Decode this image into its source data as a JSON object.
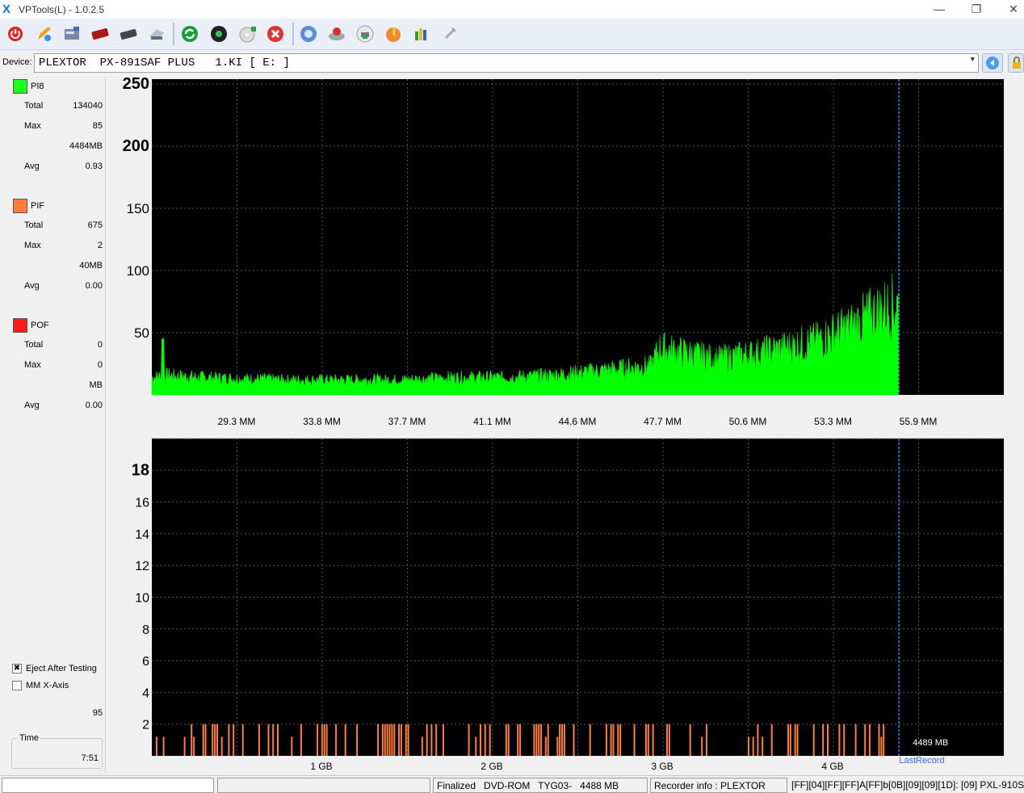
{
  "window": {
    "title": "VPTools(L) - 1.0.2.5",
    "logo": "X",
    "minimize": "—",
    "maximize": "❐",
    "close": "✕"
  },
  "toolbar": {
    "icons": [
      "power-icon",
      "pencil-icon",
      "drive-info-icon",
      "disc-red-icon",
      "disc-dark-icon",
      "scanner-icon",
      "refresh-icon",
      "disc-scan-icon",
      "disc-add-icon",
      "stop-icon",
      "disc-blue-icon",
      "disc-burn-icon",
      "printer-icon",
      "fire-icon",
      "chart-icon",
      "settings-icon"
    ]
  },
  "device": {
    "label": "Device:",
    "value": "PLEXTOR  PX-891SAF PLUS   1.KI [ E: ]",
    "arrow": "▼"
  },
  "stats": {
    "pi8": {
      "name": "PI8",
      "color": "#1dff1d",
      "total_label": "Total",
      "total": "134040",
      "max_label": "Max",
      "max": "85",
      "max_pos": "4484MB",
      "avg_label": "Avg",
      "avg": "0.93"
    },
    "pif": {
      "name": "PIF",
      "color": "#ff7f3a",
      "total_label": "Total",
      "total": "675",
      "max_label": "Max",
      "max": "2",
      "max_pos": "40MB",
      "avg_label": "Avg",
      "avg": "0.00"
    },
    "pof": {
      "name": "POF",
      "color": "#ff1c1c",
      "total_label": "Total",
      "total": "0",
      "max_label": "Max",
      "max": "0",
      "max_pos": "MB",
      "avg_label": "Avg",
      "avg": "0.00"
    }
  },
  "options": {
    "eject_label": "Eject After Testing",
    "eject_checked": "✖",
    "mm_label": "MM X-Axis",
    "speed_value": "95",
    "time_label": "Time",
    "time_value": "7:51"
  },
  "chart_data": [
    {
      "type": "area",
      "series": [
        {
          "name": "PI8",
          "color": "#00ff00"
        }
      ],
      "y_ticks": [
        50,
        100,
        150,
        200,
        250
      ],
      "ylim": [
        0,
        250
      ],
      "x_tick_labels": [
        "29.3 MM",
        "33.8 MM",
        "37.7 MM",
        "41.1 MM",
        "44.6 MM",
        "47.7 MM",
        "50.6 MM",
        "53.3 MM",
        "55.9 MM"
      ],
      "x_data_range_mb": [
        0,
        4489
      ],
      "envelope": [
        [
          0,
          15
        ],
        [
          80,
          17
        ],
        [
          300,
          15
        ],
        [
          800,
          13
        ],
        [
          1200,
          13
        ],
        [
          1500,
          13
        ],
        [
          1800,
          15
        ],
        [
          2100,
          15
        ],
        [
          2400,
          17
        ],
        [
          2700,
          21
        ],
        [
          3000,
          25
        ],
        [
          3050,
          40
        ],
        [
          3200,
          36
        ],
        [
          3400,
          31
        ],
        [
          3600,
          35
        ],
        [
          3800,
          40
        ],
        [
          4000,
          46
        ],
        [
          4200,
          58
        ],
        [
          4350,
          70
        ],
        [
          4484,
          78
        ]
      ],
      "last_record_mb": 4489,
      "background": "#000000",
      "grid": true
    },
    {
      "type": "bar",
      "series": [
        {
          "name": "PIF",
          "color": "#ff7f3a"
        }
      ],
      "y_ticks": [
        2,
        4,
        6,
        8,
        10,
        12,
        14,
        16,
        18
      ],
      "ylim": [
        0,
        20
      ],
      "x_tick_labels": [
        "1 GB",
        "2 GB",
        "3 GB",
        "4 GB"
      ],
      "x_data_range_mb": [
        0,
        4489
      ],
      "bar_value": 2,
      "last_record_mb": 4489,
      "last_record_value": "4489 MB",
      "last_record_label": "LastRecord",
      "background": "#000000",
      "grid": true
    }
  ],
  "status": {
    "seg1": "",
    "seg2": "",
    "disc": "Finalized   DVD-ROM   TYG03-   4488 MB",
    "recorder": "Recorder info  : PLEXTOR",
    "codes": "[FF][04][FF][FF]A[FF]b[0B][09][09][1D]: [09] PXL-910S"
  }
}
